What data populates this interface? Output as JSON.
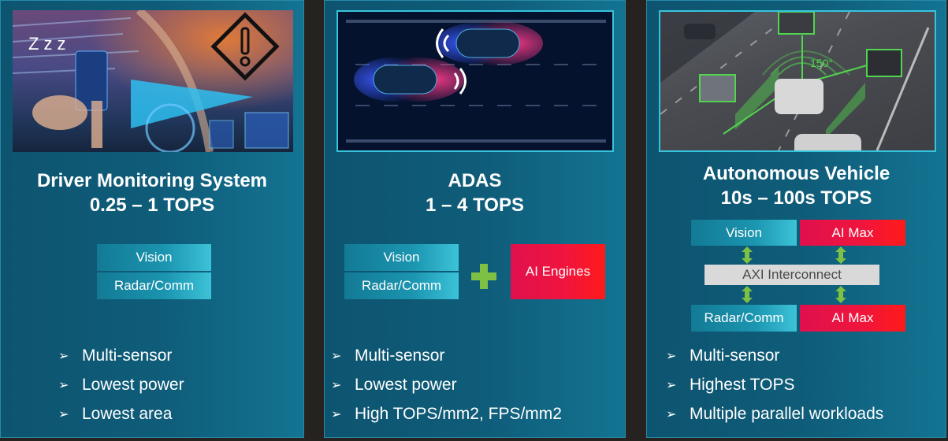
{
  "panels": [
    {
      "scene": {
        "label": "Zzz",
        "icon": "warning-sign-icon",
        "description": "drowsy driver inside car cabin"
      },
      "title_line1": "Driver Monitoring System",
      "title_line2": "0.25 – 1 TOPS",
      "blocks": {
        "vision": "Vision",
        "radar": "Radar/Comm"
      },
      "bullets": [
        "Multi-sensor",
        "Lowest power",
        "Lowest area"
      ]
    },
    {
      "scene": {
        "description": "two cars on road with radar signal arcs"
      },
      "title_line1": "ADAS",
      "title_line2": "1 – 4 TOPS",
      "blocks": {
        "vision": "Vision",
        "radar": "Radar/Comm",
        "ai": "AI Engines"
      },
      "bullets": [
        "Multi-sensor",
        "Lowest power",
        "High TOPS/mm2, FPS/mm2"
      ]
    },
    {
      "scene": {
        "angle_label": "150°",
        "description": "highway with detected vehicles in bounding boxes"
      },
      "title_line1": "Autonomous Vehicle",
      "title_line2": "10s – 100s TOPS",
      "blocks": {
        "vision": "Vision",
        "ai_top": "AI Max",
        "interconnect": "AXI Interconnect",
        "radar": "Radar/Comm",
        "ai_bottom": "AI Max"
      },
      "bullets": [
        "Multi-sensor",
        "Highest TOPS",
        "Multiple parallel workloads"
      ]
    }
  ],
  "bullet_glyph": "➢",
  "colors": {
    "panel": "#0f5d7a",
    "teal_block": "#1b95b0",
    "red_block": "#f0153c",
    "grey_block": "#d9d9d9",
    "green_arrow": "#7ec043",
    "frame": "#36c4dc"
  }
}
